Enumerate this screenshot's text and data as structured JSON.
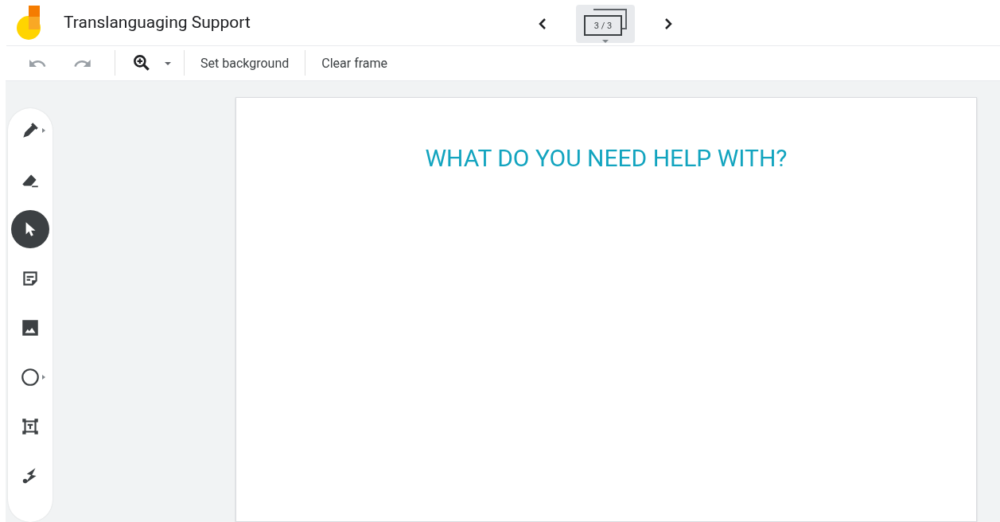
{
  "app": {
    "title": "Translanguaging Support"
  },
  "frame_nav": {
    "counter": "3 / 3"
  },
  "toolbar": {
    "buttons": [
      {
        "label": "Set background"
      },
      {
        "label": "Clear frame"
      }
    ]
  },
  "tools": [
    {
      "kind": "pen",
      "selected": false
    },
    {
      "kind": "eraser",
      "selected": false
    },
    {
      "kind": "select",
      "selected": true
    },
    {
      "kind": "sticky-note",
      "selected": false
    },
    {
      "kind": "image",
      "selected": false
    },
    {
      "kind": "circle",
      "selected": false
    },
    {
      "kind": "text-box",
      "selected": false
    },
    {
      "kind": "laser",
      "selected": false
    }
  ],
  "canvas": {
    "heading": "WHAT DO YOU NEED HELP WITH?"
  }
}
